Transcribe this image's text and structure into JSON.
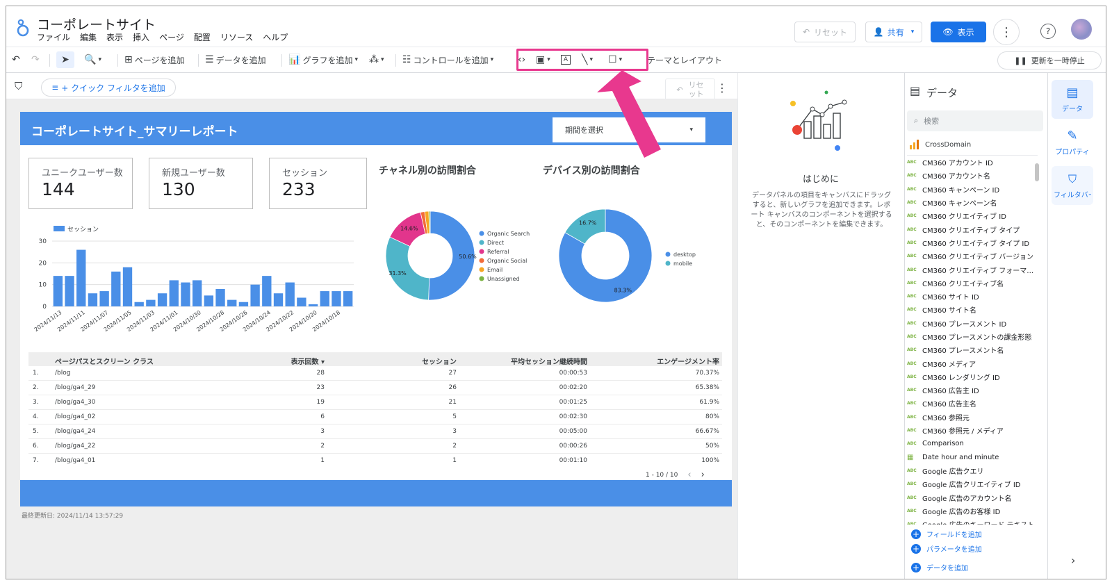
{
  "app": {
    "title": "コーポレートサイト",
    "menu": [
      "ファイル",
      "編集",
      "表示",
      "挿入",
      "ページ",
      "配置",
      "リソース",
      "ヘルプ"
    ],
    "reset": "リセット",
    "share": "共有",
    "view": "表示"
  },
  "toolbar": {
    "add_page": "ページを追加",
    "add_data": "データを追加",
    "add_chart": "グラフを追加",
    "add_control": "コントロールを追加",
    "theme_layout": "テーマとレイアウト",
    "pause_update": "更新を一時停止"
  },
  "filterbar": {
    "quick_filter": "+ クイック フィルタを追加",
    "reset_line1": "リセ",
    "reset_line2": "ット"
  },
  "report": {
    "title": "コーポレートサイト_サマリーレポート",
    "period_select": "期間を選択",
    "kpis": [
      {
        "label": "ユニークユーザー数",
        "value": "144"
      },
      {
        "label": "新規ユーザー数",
        "value": "130"
      },
      {
        "label": "セッション",
        "value": "233"
      }
    ],
    "channel_title": "チャネル別の訪問割合",
    "device_title": "デバイス別の訪問割合",
    "last_updated": "最終更新日: 2024/11/14 13:57:29",
    "table": {
      "columns": [
        "ページパスとスクリーン クラス",
        "表示回数 ▾",
        "セッション",
        "平均セッション継続時間",
        "エンゲージメント率"
      ],
      "rows": [
        [
          "1.",
          "/blog",
          "28",
          "27",
          "00:00:53",
          "70.37%"
        ],
        [
          "2.",
          "/blog/ga4_29",
          "23",
          "26",
          "00:02:20",
          "65.38%"
        ],
        [
          "3.",
          "/blog/ga4_30",
          "19",
          "21",
          "00:01:25",
          "61.9%"
        ],
        [
          "4.",
          "/blog/ga4_02",
          "6",
          "5",
          "00:02:30",
          "80%"
        ],
        [
          "5.",
          "/blog/ga4_24",
          "3",
          "3",
          "00:05:00",
          "66.67%"
        ],
        [
          "6.",
          "/blog/ga4_22",
          "2",
          "2",
          "00:00:26",
          "50%"
        ],
        [
          "7.",
          "/blog/ga4_01",
          "1",
          "1",
          "00:01:10",
          "100%"
        ]
      ],
      "pager": "1 - 10 / 10"
    }
  },
  "chart_data": [
    {
      "type": "bar",
      "legend": "セッション",
      "ylim": [
        0,
        30
      ],
      "yticks": [
        0,
        10,
        20,
        30
      ],
      "x_tick_labels": [
        "2024/11/13",
        "2024/11/11",
        "2024/11/07",
        "2024/11/05",
        "2024/11/03",
        "2024/11/01",
        "2024/10/30",
        "2024/10/28",
        "2024/10/26",
        "2024/10/24",
        "2024/10/22",
        "2024/10/20",
        "2024/10/18"
      ],
      "values": [
        14,
        14,
        26,
        6,
        7,
        16,
        18,
        2,
        3,
        6,
        12,
        11,
        12,
        5,
        8,
        3,
        2,
        10,
        14,
        6,
        11,
        4,
        1,
        7,
        7,
        7
      ],
      "color": "#4a8fe7"
    },
    {
      "type": "pie",
      "title": "チャネル別の訪問割合",
      "labels": [
        "Organic Search",
        "Direct",
        "Referral",
        "Organic Social",
        "Email",
        "Unassigned"
      ],
      "values": [
        50.6,
        31.3,
        14.6,
        1.5,
        1.5,
        0.5
      ],
      "display_labels": [
        "50.6%",
        "31.3%",
        "14.6%",
        "",
        "",
        ""
      ],
      "colors": [
        "#4a8fe7",
        "#4fb5c9",
        "#e2358c",
        "#f26b38",
        "#f6a623",
        "#7cb342"
      ]
    },
    {
      "type": "pie",
      "title": "デバイス別の訪問割合",
      "labels": [
        "desktop",
        "mobile"
      ],
      "values": [
        83.3,
        16.7
      ],
      "display_labels": [
        "83.3%",
        "16.7%"
      ],
      "colors": [
        "#4a8fe7",
        "#4fb5c9"
      ]
    }
  ],
  "getting_started": {
    "title": "はじめに",
    "text": "データパネルの項目をキャンバスにドラッグすると、新しいグラフを追加できます。レポート キャンバスのコンポーネントを選択すると、そのコンポーネントを編集できます。"
  },
  "data_panel": {
    "title": "データ",
    "search_placeholder": "検索",
    "source": "CrossDomain",
    "fields": [
      "CM360 アカウント ID",
      "CM360 アカウント名",
      "CM360 キャンペーン ID",
      "CM360 キャンペーン名",
      "CM360 クリエイティブ ID",
      "CM360 クリエイティブ タイプ",
      "CM360 クリエイティブ タイプ ID",
      "CM360 クリエイティブ バージョン",
      "CM360 クリエイティブ フォーマット",
      "CM360 クリエイティブ名",
      "CM360 サイト ID",
      "CM360 サイト名",
      "CM360 プレースメント ID",
      "CM360 プレースメントの課金形態",
      "CM360 プレースメント名",
      "CM360 メディア",
      "CM360 レンダリング ID",
      "CM360 広告主 ID",
      "CM360 広告主名",
      "CM360 参照元",
      "CM360 参照元 / メディア",
      "Comparison",
      "Date hour and minute",
      "Google 広告クエリ",
      "Google 広告クリエイティブ ID",
      "Google 広告のアカウント名",
      "Google 広告のお客様 ID",
      "Google 広告のキーワード テキスト"
    ],
    "add_field": "フィールドを追加",
    "add_parameter": "パラメータを追加",
    "add_data": "データを追加"
  },
  "rail": {
    "data": "データ",
    "property": "プロパティ",
    "filter": "フィルタバー"
  }
}
